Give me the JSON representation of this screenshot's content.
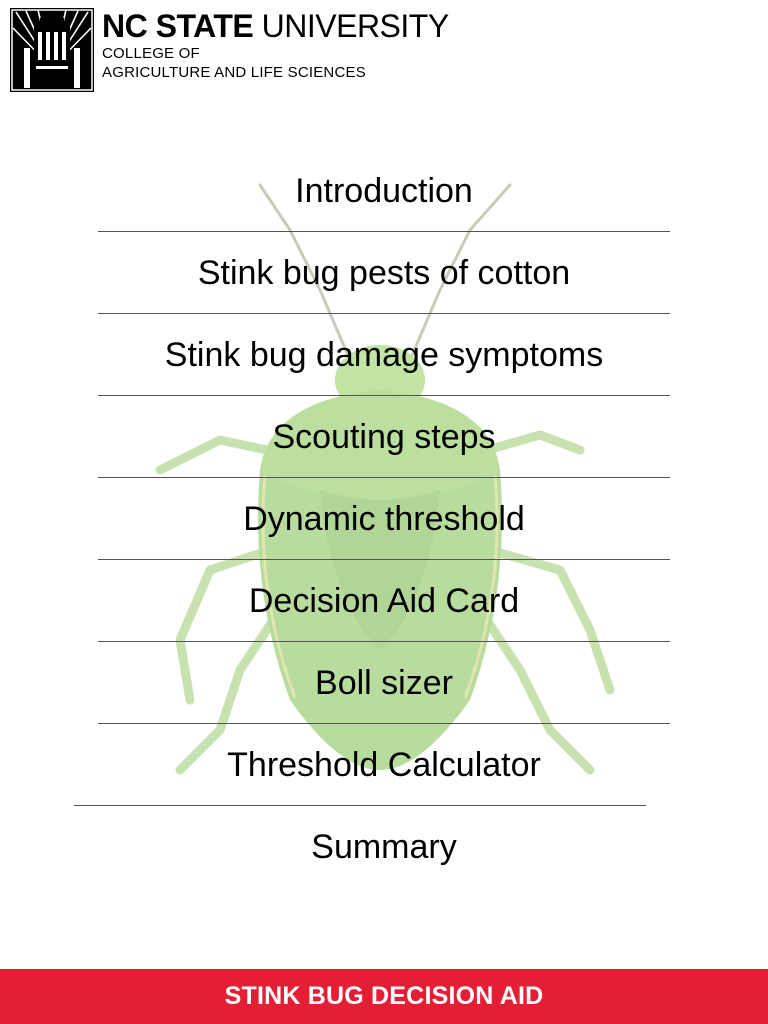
{
  "branding": {
    "university_bold": "NC STATE",
    "university_light": "UNIVERSITY",
    "college_line1": "COLLEGE OF",
    "college_line2": "AGRICULTURE AND LIFE SCIENCES",
    "logo_icon": "ncsu-belltower-icon"
  },
  "background_image": {
    "icon": "stink-bug-icon",
    "color": "#7fbf4f"
  },
  "menu": {
    "items": [
      {
        "label": "Introduction"
      },
      {
        "label": "Stink bug pests of cotton"
      },
      {
        "label": "Stink bug damage symptoms"
      },
      {
        "label": "Scouting steps"
      },
      {
        "label": "Dynamic threshold"
      },
      {
        "label": "Decision Aid Card"
      },
      {
        "label": "Boll sizer"
      },
      {
        "label": "Threshold Calculator"
      },
      {
        "label": "Summary"
      }
    ]
  },
  "footer": {
    "title": "STINK BUG DECISION AID",
    "color": "#e41f35"
  }
}
